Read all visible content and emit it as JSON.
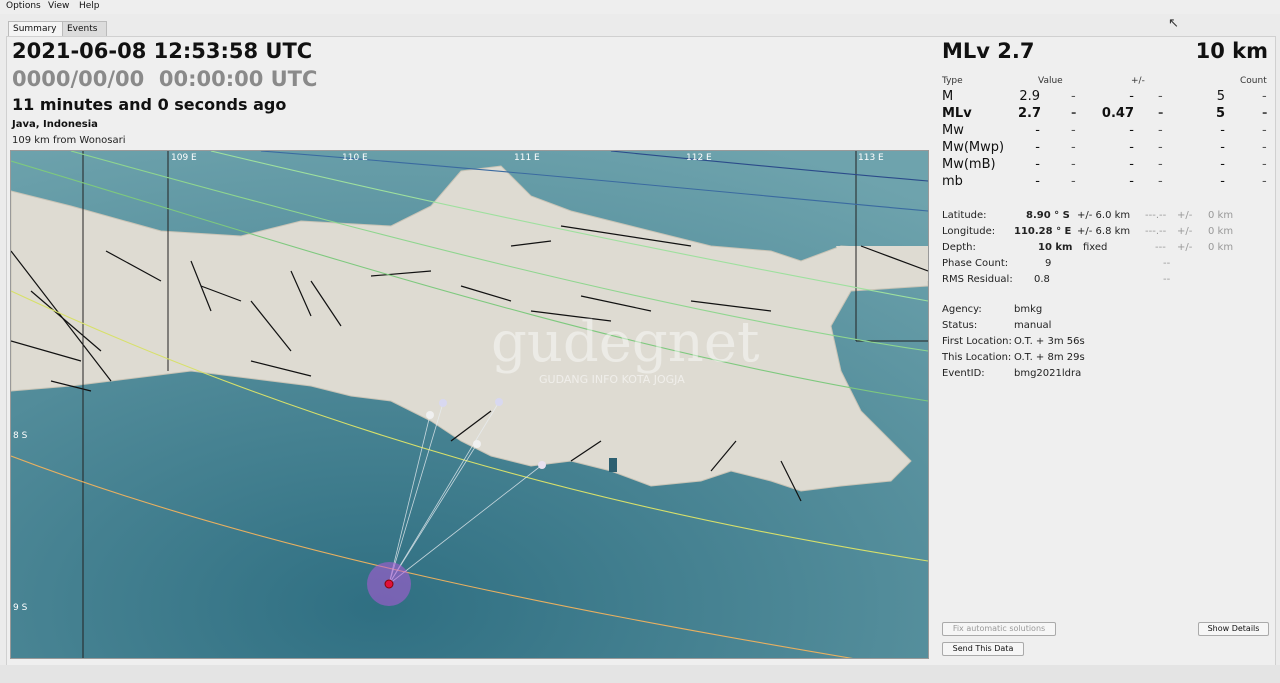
{
  "menu": [
    "Options",
    "View",
    "Help"
  ],
  "tabs": [
    "Summary",
    "Events"
  ],
  "summary": {
    "origin_time": "2021-06-08 12:53:58 UTC",
    "alt_time": "0000/00/00  00:00:00 UTC",
    "elapsed": "11 minutes and 0 seconds ago",
    "region": "Java, Indonesia",
    "nearest": "109 km from Wonosari"
  },
  "map": {
    "lon_labels": [
      "109 E",
      "110 E",
      "111 E",
      "112 E",
      "113 E"
    ],
    "lat_labels": [
      "8 S",
      "9 S"
    ],
    "watermark_main": "gudegnet",
    "watermark_sub": "GUDANG INFO KOTA JOGJA"
  },
  "side": {
    "magnitude": "MLv 2.7",
    "depth": "10 km",
    "headers": {
      "type": "Type",
      "value": "Value",
      "pm": "+/-",
      "count": "Count"
    },
    "magnitudes": [
      {
        "type": "M",
        "value": "2.9",
        "c1": "-",
        "pm": "-",
        "c2": "-",
        "count": "5",
        "c3": "-",
        "bold": false
      },
      {
        "type": "MLv",
        "value": "2.7",
        "c1": "-",
        "pm": "0.47",
        "c2": "-",
        "count": "5",
        "c3": "-",
        "bold": true
      },
      {
        "type": "Mw",
        "value": "-",
        "c1": "-",
        "pm": "-",
        "c2": "-",
        "count": "-",
        "c3": "-",
        "bold": false
      },
      {
        "type": "Mw(Mwp)",
        "value": "-",
        "c1": "-",
        "pm": "-",
        "c2": "-",
        "count": "-",
        "c3": "-",
        "bold": false
      },
      {
        "type": "Mw(mB)",
        "value": "-",
        "c1": "-",
        "pm": "-",
        "c2": "-",
        "count": "-",
        "c3": "-",
        "bold": false
      },
      {
        "type": "mb",
        "value": "-",
        "c1": "-",
        "pm": "-",
        "c2": "-",
        "count": "-",
        "c3": "-",
        "bold": false
      }
    ],
    "details": {
      "latitude_label": "Latitude:",
      "latitude_value": "8.90 ° S",
      "latitude_unc": "+/- 6.0 km",
      "latitude_alt": "---.--",
      "latitude_alt_pm": "+/-",
      "latitude_alt_unc": "0 km",
      "longitude_label": "Longitude:",
      "longitude_value": "110.28 ° E",
      "longitude_unc": "+/- 6.8 km",
      "longitude_alt": "---.--",
      "longitude_alt_pm": "+/-",
      "longitude_alt_unc": "0 km",
      "depth_label": "Depth:",
      "depth_value": "10 km",
      "depth_unc": "fixed",
      "depth_alt": "---",
      "depth_alt_pm": "+/-",
      "depth_alt_unc": "0 km",
      "phase_label": "Phase Count:",
      "phase_value": "9",
      "phase_alt": "--",
      "rms_label": "RMS Residual:",
      "rms_value": "0.8",
      "rms_alt": "--",
      "agency_label": "Agency:",
      "agency_value": "bmkg",
      "status_label": "Status:",
      "status_value": "manual",
      "first_label": "First Location:",
      "first_value": "O.T. + 3m 56s",
      "this_label": "This Location:",
      "this_value": "O.T. + 8m 29s",
      "event_label": "EventID:",
      "event_value": "bmg2021ldra"
    },
    "buttons": {
      "fix": "Fix automatic solutions",
      "show": "Show Details",
      "send": "Send This Data"
    }
  }
}
